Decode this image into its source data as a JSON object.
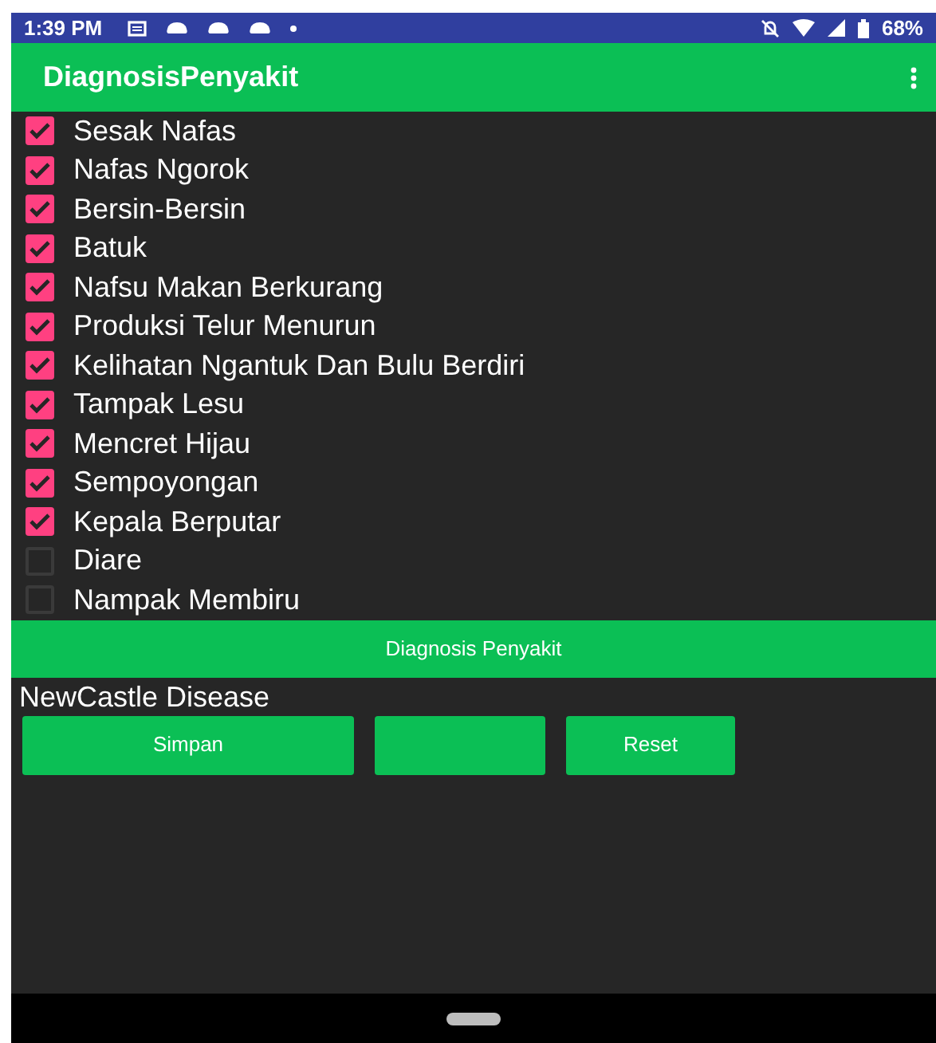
{
  "status_bar": {
    "time": "1:39 PM",
    "battery": "68%"
  },
  "app_bar": {
    "title": "DiagnosisPenyakit"
  },
  "symptoms": [
    {
      "label": "Sesak Nafas",
      "checked": true
    },
    {
      "label": "Nafas Ngorok",
      "checked": true
    },
    {
      "label": "Bersin-Bersin",
      "checked": true
    },
    {
      "label": "Batuk",
      "checked": true
    },
    {
      "label": "Nafsu Makan Berkurang",
      "checked": true
    },
    {
      "label": "Produksi Telur Menurun",
      "checked": true
    },
    {
      "label": "Kelihatan Ngantuk Dan Bulu Berdiri",
      "checked": true
    },
    {
      "label": "Tampak Lesu",
      "checked": true
    },
    {
      "label": "Mencret Hijau",
      "checked": true
    },
    {
      "label": "Sempoyongan",
      "checked": true
    },
    {
      "label": "Kepala Berputar",
      "checked": true
    },
    {
      "label": "Diare",
      "checked": false
    },
    {
      "label": "Nampak Membiru",
      "checked": false
    }
  ],
  "diagnose_button": "Diagnosis Penyakit",
  "result": "NewCastle Disease",
  "buttons": [
    {
      "kind": "save",
      "label": "Simpan"
    },
    {
      "kind": "blank"
    },
    {
      "kind": "reset",
      "label": "Reset"
    }
  ]
}
